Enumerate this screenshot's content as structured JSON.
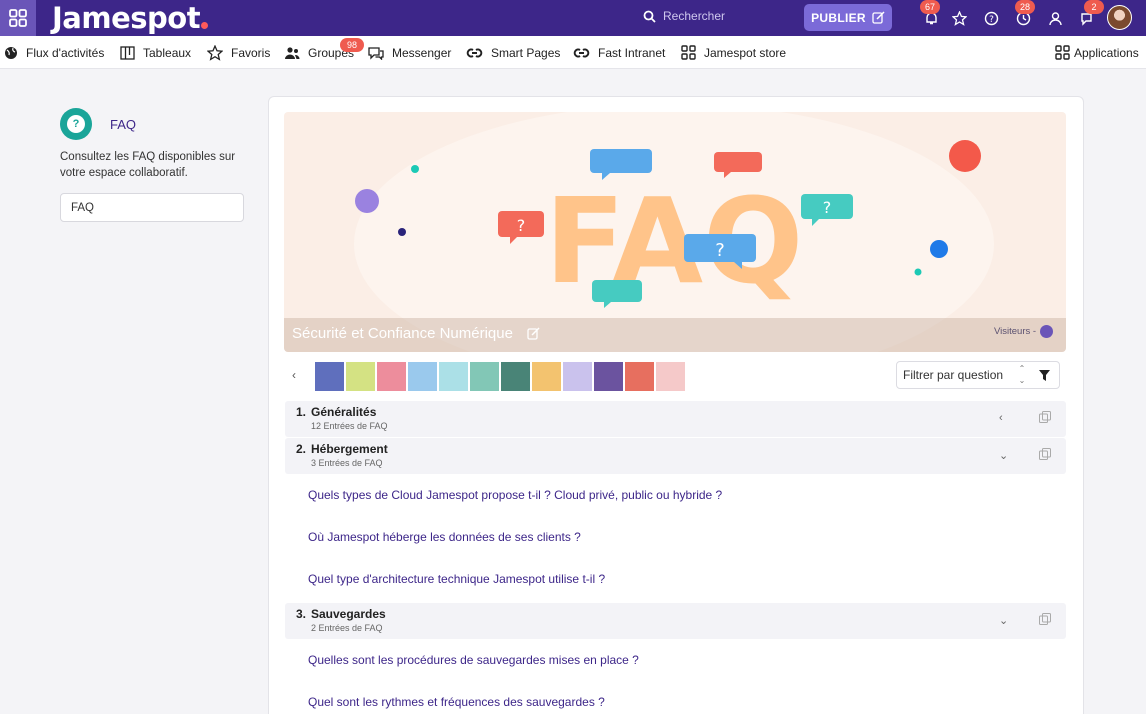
{
  "topbar": {
    "logo": "Jamespot",
    "search_placeholder": "Rechercher",
    "publish_label": "PUBLIER",
    "badges": {
      "notifications": "67",
      "history": "28",
      "messages": "2"
    }
  },
  "nav": {
    "items": [
      {
        "label": "Flux d'activités",
        "icon": "globe-icon"
      },
      {
        "label": "Tableaux",
        "icon": "board-icon"
      },
      {
        "label": "Favoris",
        "icon": "star-icon"
      },
      {
        "label": "Groupes",
        "icon": "group-icon",
        "badge": "98"
      },
      {
        "label": "Messenger",
        "icon": "chat-icon"
      },
      {
        "label": "Smart Pages",
        "icon": "link-icon"
      },
      {
        "label": "Fast Intranet",
        "icon": "link-icon"
      },
      {
        "label": "Jamespot store",
        "icon": "grid-icon"
      }
    ],
    "applications_label": "Applications"
  },
  "sidebar": {
    "title": "FAQ",
    "description": "Consultez les FAQ disponibles sur votre espace collaboratif.",
    "input_value": "FAQ"
  },
  "banner": {
    "image_text": "FAQ",
    "title": "Sécurité et Confiance Numérique",
    "visibility": "Visiteurs -"
  },
  "filter": {
    "label": "Filtrer par question"
  },
  "thumbnail_colors": [
    "#2a3fa8",
    "#c6d95a",
    "#e8677c",
    "#79b8e8",
    "#8fd6e0",
    "#59b59e",
    "#0d5b4a",
    "#f0b040",
    "#b9aee8",
    "#3a1a80",
    "#e0402a",
    "#f2b8b8"
  ],
  "sections": [
    {
      "num": "1.",
      "title": "Généralités",
      "count": "12 Entrées de FAQ",
      "chevron": "‹",
      "questions": []
    },
    {
      "num": "2.",
      "title": "Hébergement",
      "count": "3 Entrées de FAQ",
      "chevron": "⌄",
      "questions": [
        "Quels types de Cloud Jamespot propose t-il ? Cloud privé, public ou hybride ?",
        "Où Jamespot héberge les données de ses clients ?",
        "Quel type d'architecture technique Jamespot utilise t-il ?"
      ]
    },
    {
      "num": "3.",
      "title": "Sauvegardes",
      "count": "2 Entrées de FAQ",
      "chevron": "⌄",
      "questions": [
        "Quelles sont les procédures de sauvegardes mises en place ?",
        "Quel sont les rythmes et fréquences des sauvegardes ?"
      ]
    }
  ],
  "colors": {
    "brand": "#3d2689",
    "accent": "#7b6ad8",
    "faq_icon": "#1aa599",
    "badge": "#ef5b4f"
  }
}
